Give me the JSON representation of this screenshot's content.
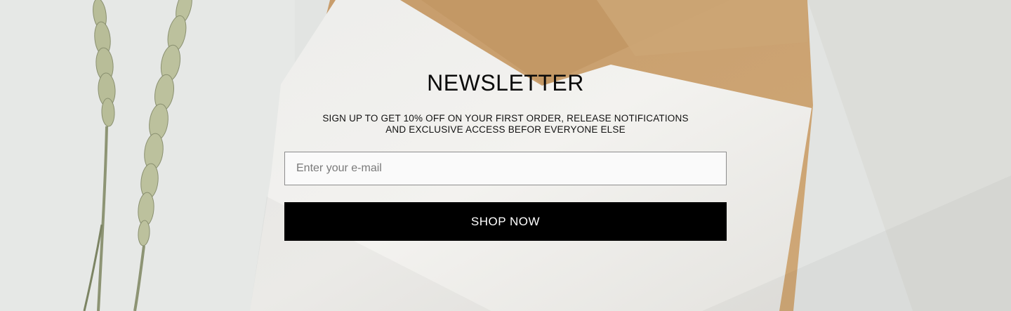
{
  "newsletter": {
    "title": "NEWSLETTER",
    "subtitle_line1": "SIGN UP TO GET 10% OFF ON YOUR FIRST ORDER, RELEASE NOTIFICATIONS",
    "subtitle_line2": "AND EXCLUSIVE ACCESS BEFOR EVERYONE ELSE",
    "email_placeholder": "Enter your e-mail",
    "email_value": "",
    "button_label": "SHOP NOW"
  },
  "colors": {
    "button_bg": "#000000",
    "button_text": "#ffffff",
    "envelope": "#c9a170",
    "card": "#f1f0ec",
    "background": "#e3e5e3"
  }
}
